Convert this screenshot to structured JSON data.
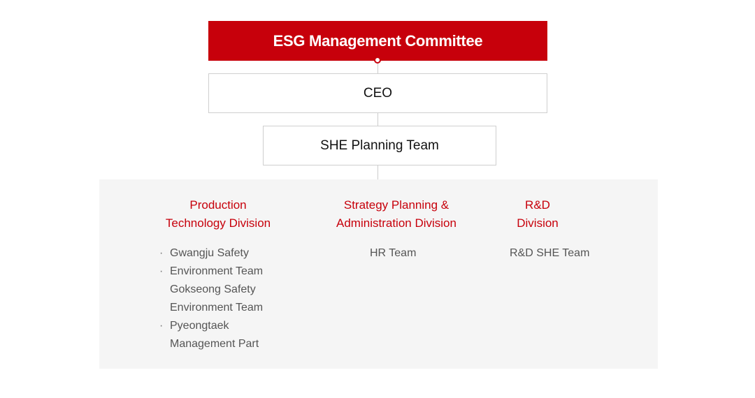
{
  "committee": {
    "label": "ESG Management Committee"
  },
  "ceo": {
    "label": "CEO"
  },
  "she_planning": {
    "label": "SHE Planning Team"
  },
  "divisions": {
    "production": {
      "title_line1": "Production",
      "title_line2": "Technology Division",
      "teams": [
        {
          "text": "Gwangju Safety",
          "bullet": true
        },
        {
          "text": "Environment Team",
          "bullet": true
        },
        {
          "text": "Gokseong Safety",
          "bullet": false
        },
        {
          "text": "Environment Team",
          "bullet": false
        },
        {
          "text": "Pyeongtaek",
          "bullet": true
        },
        {
          "text": "Management Part",
          "bullet": false
        }
      ]
    },
    "strategy": {
      "title_line1": "Strategy Planning &",
      "title_line2": "Administration Division",
      "team": "HR Team"
    },
    "rnd": {
      "title_line1": "R&D",
      "title_line2": "Division",
      "team": "R&D SHE Team"
    }
  },
  "colors": {
    "accent": "#c7000b",
    "panel": "#f5f5f5",
    "border": "#cfcfcf"
  }
}
